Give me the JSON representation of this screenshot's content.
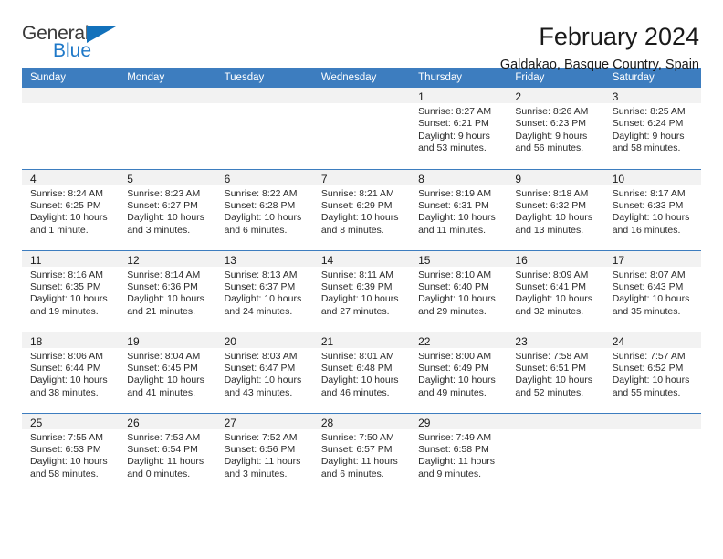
{
  "logo": {
    "word_one": "General",
    "word_two": "Blue",
    "triangle_color": "#1271bb",
    "blue_color": "#1e78c8"
  },
  "header": {
    "title": "February 2024",
    "location": "Galdakao, Basque Country, Spain"
  },
  "theme": {
    "header_bg": "#3d7dbf",
    "header_text": "#ffffff",
    "daynum_bg": "#f2f2f2",
    "row_divider": "#3d7dbf",
    "body_text": "#2b2b2b"
  },
  "weekday_headers": [
    "Sunday",
    "Monday",
    "Tuesday",
    "Wednesday",
    "Thursday",
    "Friday",
    "Saturday"
  ],
  "labels": {
    "sunrise_prefix": "Sunrise:",
    "sunset_prefix": "Sunset:",
    "daylight_prefix": "Daylight:"
  },
  "weeks": [
    [
      {
        "day": "",
        "empty": true
      },
      {
        "day": "",
        "empty": true
      },
      {
        "day": "",
        "empty": true
      },
      {
        "day": "",
        "empty": true
      },
      {
        "day": "1",
        "sunrise": "Sunrise: 8:27 AM",
        "sunset": "Sunset: 6:21 PM",
        "daylight": "Daylight: 9 hours and 53 minutes."
      },
      {
        "day": "2",
        "sunrise": "Sunrise: 8:26 AM",
        "sunset": "Sunset: 6:23 PM",
        "daylight": "Daylight: 9 hours and 56 minutes."
      },
      {
        "day": "3",
        "sunrise": "Sunrise: 8:25 AM",
        "sunset": "Sunset: 6:24 PM",
        "daylight": "Daylight: 9 hours and 58 minutes."
      }
    ],
    [
      {
        "day": "4",
        "sunrise": "Sunrise: 8:24 AM",
        "sunset": "Sunset: 6:25 PM",
        "daylight": "Daylight: 10 hours and 1 minute."
      },
      {
        "day": "5",
        "sunrise": "Sunrise: 8:23 AM",
        "sunset": "Sunset: 6:27 PM",
        "daylight": "Daylight: 10 hours and 3 minutes."
      },
      {
        "day": "6",
        "sunrise": "Sunrise: 8:22 AM",
        "sunset": "Sunset: 6:28 PM",
        "daylight": "Daylight: 10 hours and 6 minutes."
      },
      {
        "day": "7",
        "sunrise": "Sunrise: 8:21 AM",
        "sunset": "Sunset: 6:29 PM",
        "daylight": "Daylight: 10 hours and 8 minutes."
      },
      {
        "day": "8",
        "sunrise": "Sunrise: 8:19 AM",
        "sunset": "Sunset: 6:31 PM",
        "daylight": "Daylight: 10 hours and 11 minutes."
      },
      {
        "day": "9",
        "sunrise": "Sunrise: 8:18 AM",
        "sunset": "Sunset: 6:32 PM",
        "daylight": "Daylight: 10 hours and 13 minutes."
      },
      {
        "day": "10",
        "sunrise": "Sunrise: 8:17 AM",
        "sunset": "Sunset: 6:33 PM",
        "daylight": "Daylight: 10 hours and 16 minutes."
      }
    ],
    [
      {
        "day": "11",
        "sunrise": "Sunrise: 8:16 AM",
        "sunset": "Sunset: 6:35 PM",
        "daylight": "Daylight: 10 hours and 19 minutes."
      },
      {
        "day": "12",
        "sunrise": "Sunrise: 8:14 AM",
        "sunset": "Sunset: 6:36 PM",
        "daylight": "Daylight: 10 hours and 21 minutes."
      },
      {
        "day": "13",
        "sunrise": "Sunrise: 8:13 AM",
        "sunset": "Sunset: 6:37 PM",
        "daylight": "Daylight: 10 hours and 24 minutes."
      },
      {
        "day": "14",
        "sunrise": "Sunrise: 8:11 AM",
        "sunset": "Sunset: 6:39 PM",
        "daylight": "Daylight: 10 hours and 27 minutes."
      },
      {
        "day": "15",
        "sunrise": "Sunrise: 8:10 AM",
        "sunset": "Sunset: 6:40 PM",
        "daylight": "Daylight: 10 hours and 29 minutes."
      },
      {
        "day": "16",
        "sunrise": "Sunrise: 8:09 AM",
        "sunset": "Sunset: 6:41 PM",
        "daylight": "Daylight: 10 hours and 32 minutes."
      },
      {
        "day": "17",
        "sunrise": "Sunrise: 8:07 AM",
        "sunset": "Sunset: 6:43 PM",
        "daylight": "Daylight: 10 hours and 35 minutes."
      }
    ],
    [
      {
        "day": "18",
        "sunrise": "Sunrise: 8:06 AM",
        "sunset": "Sunset: 6:44 PM",
        "daylight": "Daylight: 10 hours and 38 minutes."
      },
      {
        "day": "19",
        "sunrise": "Sunrise: 8:04 AM",
        "sunset": "Sunset: 6:45 PM",
        "daylight": "Daylight: 10 hours and 41 minutes."
      },
      {
        "day": "20",
        "sunrise": "Sunrise: 8:03 AM",
        "sunset": "Sunset: 6:47 PM",
        "daylight": "Daylight: 10 hours and 43 minutes."
      },
      {
        "day": "21",
        "sunrise": "Sunrise: 8:01 AM",
        "sunset": "Sunset: 6:48 PM",
        "daylight": "Daylight: 10 hours and 46 minutes."
      },
      {
        "day": "22",
        "sunrise": "Sunrise: 8:00 AM",
        "sunset": "Sunset: 6:49 PM",
        "daylight": "Daylight: 10 hours and 49 minutes."
      },
      {
        "day": "23",
        "sunrise": "Sunrise: 7:58 AM",
        "sunset": "Sunset: 6:51 PM",
        "daylight": "Daylight: 10 hours and 52 minutes."
      },
      {
        "day": "24",
        "sunrise": "Sunrise: 7:57 AM",
        "sunset": "Sunset: 6:52 PM",
        "daylight": "Daylight: 10 hours and 55 minutes."
      }
    ],
    [
      {
        "day": "25",
        "sunrise": "Sunrise: 7:55 AM",
        "sunset": "Sunset: 6:53 PM",
        "daylight": "Daylight: 10 hours and 58 minutes."
      },
      {
        "day": "26",
        "sunrise": "Sunrise: 7:53 AM",
        "sunset": "Sunset: 6:54 PM",
        "daylight": "Daylight: 11 hours and 0 minutes."
      },
      {
        "day": "27",
        "sunrise": "Sunrise: 7:52 AM",
        "sunset": "Sunset: 6:56 PM",
        "daylight": "Daylight: 11 hours and 3 minutes."
      },
      {
        "day": "28",
        "sunrise": "Sunrise: 7:50 AM",
        "sunset": "Sunset: 6:57 PM",
        "daylight": "Daylight: 11 hours and 6 minutes."
      },
      {
        "day": "29",
        "sunrise": "Sunrise: 7:49 AM",
        "sunset": "Sunset: 6:58 PM",
        "daylight": "Daylight: 11 hours and 9 minutes."
      },
      {
        "day": "",
        "empty": true
      },
      {
        "day": "",
        "empty": true
      }
    ]
  ]
}
